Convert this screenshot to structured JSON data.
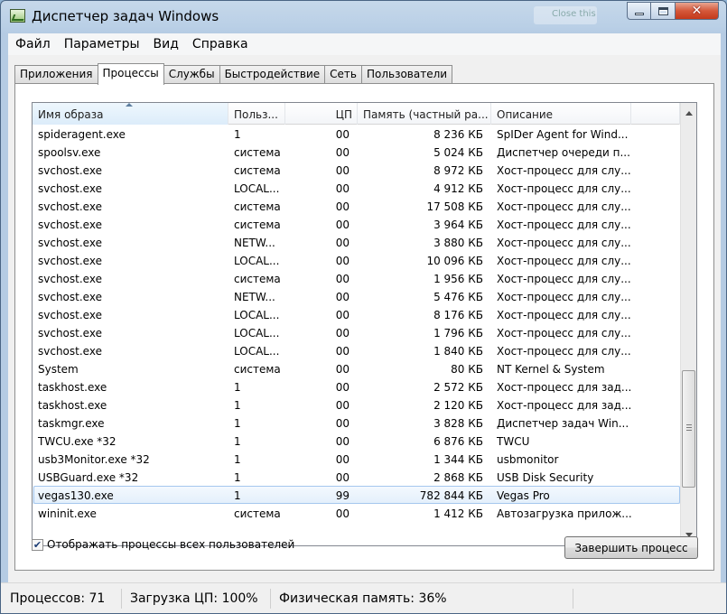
{
  "window": {
    "title": "Диспетчер задач Windows",
    "background_hint": "Close this"
  },
  "menu": [
    "Файл",
    "Параметры",
    "Вид",
    "Справка"
  ],
  "tabs": [
    "Приложения",
    "Процессы",
    "Службы",
    "Быстродействие",
    "Сеть",
    "Пользователи"
  ],
  "active_tab": "Процессы",
  "table": {
    "columns": [
      "Имя образа",
      "Польз...",
      "ЦП",
      "Память (частный ра...",
      "Описание"
    ],
    "rows": [
      [
        "spideragent.exe",
        "1",
        "00",
        "8 236 КБ",
        "SpIDer Agent for Wind..."
      ],
      [
        "spoolsv.exe",
        "система",
        "00",
        "5 024 КБ",
        "Диспетчер очереди п..."
      ],
      [
        "svchost.exe",
        "система",
        "00",
        "8 972 КБ",
        "Хост-процесс для слу..."
      ],
      [
        "svchost.exe",
        "LOCAL...",
        "00",
        "4 912 КБ",
        "Хост-процесс для слу..."
      ],
      [
        "svchost.exe",
        "система",
        "00",
        "17 508 КБ",
        "Хост-процесс для слу..."
      ],
      [
        "svchost.exe",
        "система",
        "00",
        "3 964 КБ",
        "Хост-процесс для слу..."
      ],
      [
        "svchost.exe",
        "NETW...",
        "00",
        "3 880 КБ",
        "Хост-процесс для слу..."
      ],
      [
        "svchost.exe",
        "LOCAL...",
        "00",
        "10 096 КБ",
        "Хост-процесс для слу..."
      ],
      [
        "svchost.exe",
        "система",
        "00",
        "1 956 КБ",
        "Хост-процесс для слу..."
      ],
      [
        "svchost.exe",
        "NETW...",
        "00",
        "5 476 КБ",
        "Хост-процесс для слу..."
      ],
      [
        "svchost.exe",
        "LOCAL...",
        "00",
        "8 176 КБ",
        "Хост-процесс для слу..."
      ],
      [
        "svchost.exe",
        "LOCAL...",
        "00",
        "1 796 КБ",
        "Хост-процесс для слу..."
      ],
      [
        "svchost.exe",
        "LOCAL...",
        "00",
        "1 840 КБ",
        "Хост-процесс для слу..."
      ],
      [
        "System",
        "система",
        "00",
        "80 КБ",
        "NT Kernel & System"
      ],
      [
        "taskhost.exe",
        "1",
        "00",
        "2 572 КБ",
        "Хост-процесс для зад..."
      ],
      [
        "taskhost.exe",
        "1",
        "00",
        "2 120 КБ",
        "Хост-процесс для зад..."
      ],
      [
        "taskmgr.exe",
        "1",
        "00",
        "3 828 КБ",
        "Диспетчер задач Win..."
      ],
      [
        "TWCU.exe *32",
        "1",
        "00",
        "6 876 КБ",
        "TWCU"
      ],
      [
        "usb3Monitor.exe *32",
        "1",
        "00",
        "1 344 КБ",
        "usbmonitor"
      ],
      [
        "USBGuard.exe *32",
        "1",
        "00",
        "2 868 КБ",
        "USB Disk Security"
      ],
      [
        "vegas130.exe",
        "1",
        "99",
        "782 844 КБ",
        "Vegas Pro"
      ],
      [
        "wininit.exe",
        "система",
        "00",
        "1 412 КБ",
        "Автозагрузка прилож..."
      ]
    ],
    "selected_row": 20
  },
  "show_all_users": {
    "label": "Отображать процессы всех пользователей",
    "checked": true
  },
  "end_process_button": "Завершить процесс",
  "status": {
    "processes": "Процессов: 71",
    "cpu": "Загрузка ЦП: 100%",
    "memory": "Физическая память: 36%"
  }
}
